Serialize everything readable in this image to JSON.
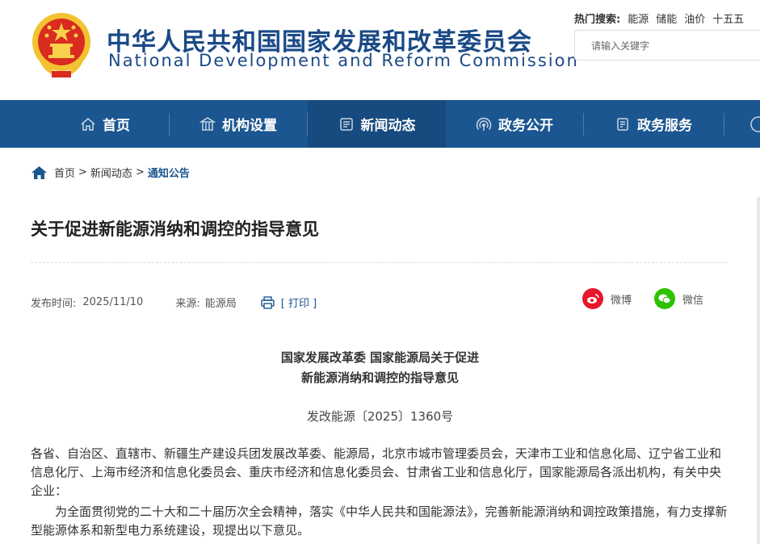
{
  "header": {
    "title_cn": "中华人民共和国国家发展和改革委员会",
    "title_en": "National Development and Reform Commission",
    "hot_label": "热门搜索:",
    "hot_keywords": [
      "能源",
      "储能",
      "油价",
      "十五五"
    ],
    "search_placeholder": "请输入关键字"
  },
  "nav": {
    "items": [
      {
        "label": "首页",
        "icon": "home-icon"
      },
      {
        "label": "机构设置",
        "icon": "institution-icon"
      },
      {
        "label": "新闻动态",
        "icon": "news-icon"
      },
      {
        "label": "政务公开",
        "icon": "broadcast-icon"
      },
      {
        "label": "政务服务",
        "icon": "document-icon"
      }
    ],
    "active_index": 2,
    "colors": {
      "bar": "#1b5690",
      "active": "#174a7e"
    }
  },
  "breadcrumb": {
    "items": [
      "首页",
      "新闻动态",
      "通知公告"
    ],
    "separator": ">"
  },
  "article": {
    "title": "关于促进新能源消纳和调控的指导意见",
    "publish_label": "发布时间:",
    "publish_date": "2025/11/10",
    "source_label": "来源:",
    "source": "能源局",
    "print_label": "[ 打印 ]",
    "share": [
      {
        "label": "微博",
        "icon": "weibo-icon",
        "color": "#e6162d"
      },
      {
        "label": "微信",
        "icon": "wechat-icon",
        "color": "#2dc100"
      }
    ],
    "doc_title_line1": "国家发展改革委 国家能源局关于促进",
    "doc_title_line2": "新能源消纳和调控的指导意见",
    "doc_number": "发改能源〔2025〕1360号",
    "recipients": "各省、自治区、直辖市、新疆生产建设兵团发展改革委、能源局，北京市城市管理委员会，天津市工业和信息化局、辽宁省工业和信息化厅、上海市经济和信息化委员会、重庆市经济和信息化委员会、甘肃省工业和信息化厅，国家能源局各派出机构，有关中央企业：",
    "intro": "为全面贯彻党的二十大和二十届历次全会精神，落实《中华人民共和国能源法》，完善新能源消纳和调控政策措施，有力支撑新型能源体系和新型电力系统建设，现提出以下意见。"
  }
}
